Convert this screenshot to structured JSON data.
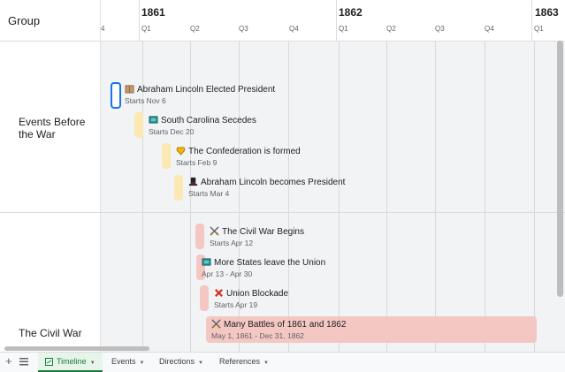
{
  "header": {
    "group_label": "Group"
  },
  "timeline": {
    "years": [
      "1861",
      "1862",
      "1863"
    ],
    "edge_label": "4",
    "quarters": [
      "Q1",
      "Q2",
      "Q3",
      "Q4",
      "Q1",
      "Q2",
      "Q3",
      "Q4",
      "Q1"
    ]
  },
  "groups": [
    {
      "label": "Events Before the War"
    },
    {
      "label": "The Civil War"
    }
  ],
  "events": [
    {
      "icon": "package-icon",
      "title": "Abraham Lincoln Elected President",
      "subtitle": "Starts Nov 6",
      "color": "#1a73e8",
      "selected": true
    },
    {
      "icon": "flag-icon",
      "title": "South Carolina Secedes",
      "subtitle": "Starts Dec 20",
      "color": "#fce8b2"
    },
    {
      "icon": "heart-icon",
      "title": "The Confederation is formed",
      "subtitle": "Starts Feb 9",
      "color": "#fce8b2"
    },
    {
      "icon": "top-hat-icon",
      "title": "Abraham Lincoln becomes President",
      "subtitle": "Starts Mar 4",
      "color": "#fce8b2"
    },
    {
      "icon": "crossed-swords-icon",
      "title": "The Civil War Begins",
      "subtitle": "Starts Apr 12",
      "color": "#f4c7c3"
    },
    {
      "icon": "flag-icon",
      "title": "More States leave the Union",
      "subtitle": "Apr 13 - Apr 30",
      "color": "#f4c7c3"
    },
    {
      "icon": "cross-mark-icon",
      "title": "Union Blockade",
      "subtitle": "Starts Apr 19",
      "color": "#f4c7c3"
    },
    {
      "icon": "crossed-swords-icon",
      "title": "Many Battles of 1861 and 1862",
      "subtitle": "May 1, 1861 - Dec 31, 1862",
      "color": "#f4c7c3"
    }
  ],
  "tabs": [
    {
      "label": "Timeline",
      "active": true
    },
    {
      "label": "Events"
    },
    {
      "label": "Directions"
    },
    {
      "label": "References"
    }
  ],
  "colors": {
    "accent": "#1a73e8",
    "pre_war": "#fce8b2",
    "war": "#f4c7c3"
  }
}
